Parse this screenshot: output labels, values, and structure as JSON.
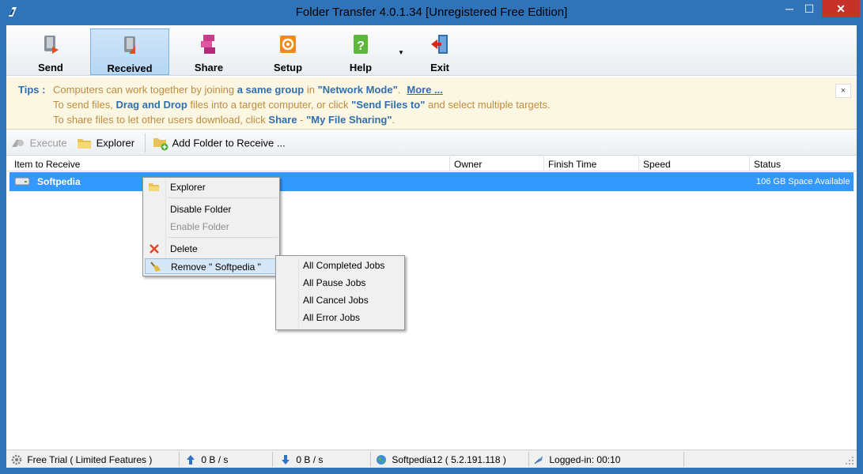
{
  "window": {
    "title": "Folder Transfer 4.0.1.34   [Unregistered Free Edition]",
    "minimize": "─",
    "maximize": "☐",
    "close": "✕"
  },
  "toolbar": {
    "buttons": [
      {
        "label": "Send",
        "icon": "send-icon"
      },
      {
        "label": "Received",
        "icon": "received-icon",
        "active": true
      },
      {
        "label": "Share",
        "icon": "share-icon"
      },
      {
        "label": "Setup",
        "icon": "setup-icon"
      },
      {
        "label": "Help",
        "icon": "help-icon"
      },
      {
        "label": "Exit",
        "icon": "exit-icon"
      }
    ],
    "help_caret": "▼"
  },
  "tips": {
    "label": "Tips :",
    "line1_a": "Computers can work together by joining ",
    "line1_b": "a same group",
    "line1_c": " in ",
    "line1_d": "\"Network Mode\"",
    "line1_e": ".",
    "more": "More ...",
    "line2_a": "To send files, ",
    "line2_b": "Drag and Drop",
    "line2_c": " files into a target computer, or click ",
    "line2_d": "\"Send Files to\"",
    "line2_e": " and select multiple targets.",
    "line3_a": "To share files to let other users download, click ",
    "line3_b": "Share",
    "line3_c": " - ",
    "line3_d": "\"My File Sharing\"",
    "line3_e": ".",
    "close": "×"
  },
  "subbar": {
    "execute": "Execute",
    "explorer": "Explorer",
    "add_folder": "Add Folder to Receive ..."
  },
  "list": {
    "columns": [
      "Item to Receive",
      "Owner",
      "Finish Time",
      "Speed",
      "Status"
    ],
    "rows": [
      {
        "name": "Softpedia",
        "owner": "",
        "finish_time": "",
        "speed": "",
        "status": "106 GB Space Available"
      }
    ]
  },
  "context_menu": {
    "items": {
      "explorer": "Explorer",
      "disable": "Disable Folder",
      "enable": "Enable Folder",
      "delete": "Delete",
      "remove": "Remove \" Softpedia \""
    },
    "submenu": [
      "All Completed Jobs",
      "All Pause Jobs",
      "All Cancel Jobs",
      "All Error Jobs"
    ]
  },
  "statusbar": {
    "trial": "Free Trial ( Limited Features )",
    "upload": "0 B / s",
    "download": "0 B / s",
    "host": "Softpedia12 ( 5.2.191.118 )",
    "logged": "Logged-in: 00:10"
  },
  "colors": {
    "title_blue": "#2f73b8",
    "selection": "#3399ff",
    "tips_bg": "#fbf7e2",
    "tips_text": "#c08b3f",
    "tips_bold": "#2f6fb0"
  }
}
